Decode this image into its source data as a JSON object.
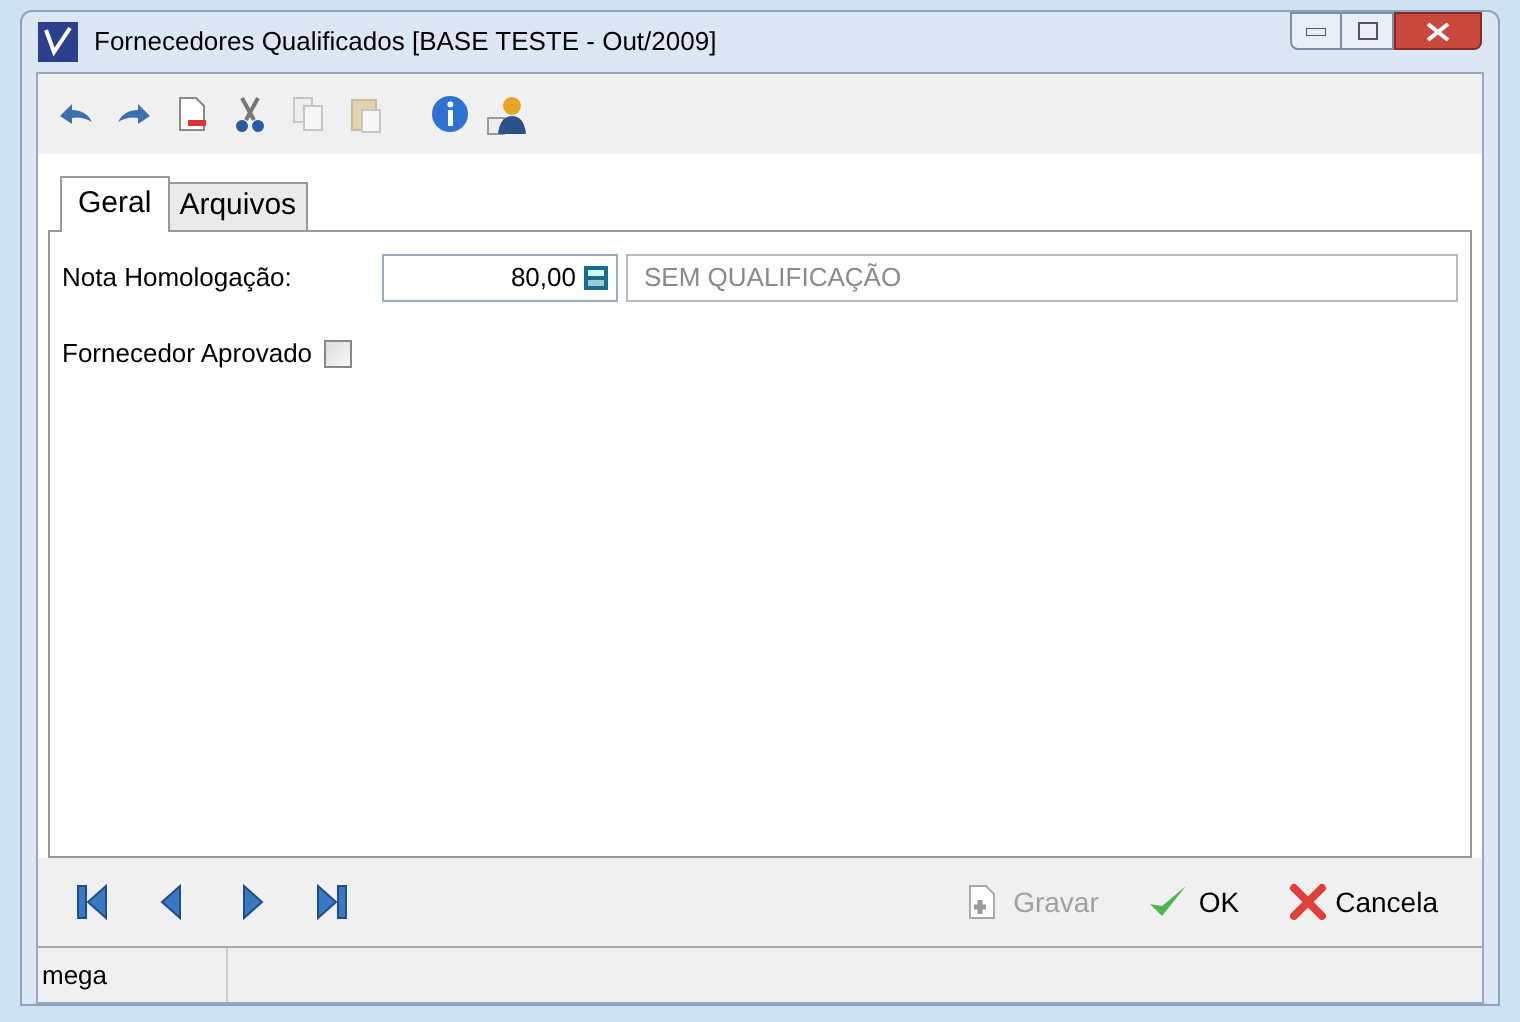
{
  "window": {
    "title": "Fornecedores Qualificados [BASE TESTE - Out/2009]"
  },
  "toolbar": [
    {
      "kind": "undo",
      "disabled": false
    },
    {
      "kind": "redo",
      "disabled": false
    },
    {
      "kind": "document",
      "disabled": false
    },
    {
      "kind": "cut",
      "disabled": false
    },
    {
      "kind": "copy",
      "disabled": true
    },
    {
      "kind": "paste",
      "disabled": true
    },
    {
      "kind": "info",
      "disabled": false
    },
    {
      "kind": "user",
      "disabled": false
    }
  ],
  "tabs": [
    {
      "label": "Geral",
      "selected": true
    },
    {
      "label": "Arquivos",
      "selected": false
    }
  ],
  "form": {
    "nota_label": "Nota Homologação:",
    "nota_value": "80,00",
    "qualificacao": "SEM QUALIFICAÇÃO",
    "aprovado_label": "Fornecedor Aprovado",
    "aprovado_checked": false
  },
  "navigation": [
    {
      "kind": "first"
    },
    {
      "kind": "prev"
    },
    {
      "kind": "next"
    },
    {
      "kind": "last"
    }
  ],
  "buttons": [
    {
      "kind": "save",
      "label": "Gravar",
      "disabled": true
    },
    {
      "kind": "ok",
      "label": "OK",
      "disabled": false
    },
    {
      "kind": "cancel",
      "label": "Cancela",
      "disabled": false
    }
  ],
  "status_bar": {
    "user": "mega"
  }
}
